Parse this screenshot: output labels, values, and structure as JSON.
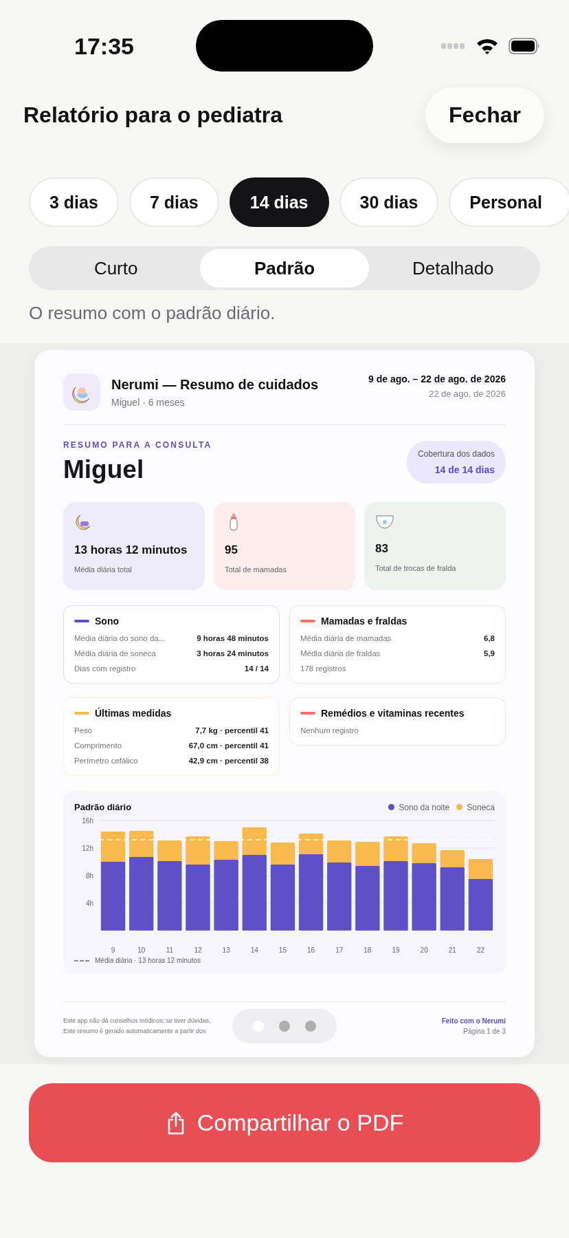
{
  "status_bar": {
    "time": "17:35"
  },
  "header": {
    "title": "Relatório para o pediatra",
    "close_button": "Fechar"
  },
  "ranges": [
    {
      "label": "3 dias",
      "selected": false
    },
    {
      "label": "7 dias",
      "selected": false
    },
    {
      "label": "14 dias",
      "selected": true
    },
    {
      "label": "30 dias",
      "selected": false
    },
    {
      "label": "Personal",
      "selected": false
    }
  ],
  "detail_levels": [
    {
      "label": "Curto",
      "selected": false
    },
    {
      "label": "Padrão",
      "selected": true
    },
    {
      "label": "Detalhado",
      "selected": false
    }
  ],
  "detail_description": "O resumo com o padrão diário.",
  "report": {
    "title": "Nerumi — Resumo de cuidados",
    "subtitle": "Miguel · 6 meses",
    "period": "9 de ago. – 22 de ago. de 2026",
    "generated": "22 de ago. de 2026",
    "kicker": "RESUMO PARA A CONSULTA",
    "child_name": "Miguel",
    "coverage": {
      "label": "Cobertura dos dados",
      "value": "14 de 14 dias"
    },
    "stats": [
      {
        "kind": "sleep",
        "value": "13 horas 12 minutos",
        "label": "Média diária total",
        "color": "#eeebfa"
      },
      {
        "kind": "bottle",
        "value": "95",
        "label": "Total de mamadas",
        "color": "#fdeeed"
      },
      {
        "kind": "diaper",
        "value": "83",
        "label": "Total de trocas de fralda",
        "color": "#eef3ef"
      }
    ],
    "sections": [
      {
        "title": "Sono",
        "color": "#5e4fc9",
        "rows": [
          {
            "label": "Média diária do sono da...",
            "value": "9 horas 48 minutos"
          },
          {
            "label": "Média diária de soneca",
            "value": "3 horas 24 minutos"
          },
          {
            "label": "Dias com registro",
            "value": "14 / 14"
          }
        ]
      },
      {
        "title": "Mamadas e fraldas",
        "color": "#f0735f",
        "rows": [
          {
            "label": "Média diária de mamadas",
            "value": "6,8"
          },
          {
            "label": "Média diária de fraldas",
            "value": "5,9"
          },
          {
            "label": "178 registros"
          }
        ]
      },
      {
        "title": "Últimas medidas",
        "color": "#f5bd4f",
        "rows": [
          {
            "label": "Peso",
            "value": "7,7 kg · percentil 41"
          },
          {
            "label": "Comprimento",
            "value": "67,0 cm · percentil 41"
          },
          {
            "label": "Perímetro cefálico",
            "value": "42,9 cm · percentil 38"
          }
        ]
      },
      {
        "title": "Remédios e vitaminas recentes",
        "color": "#f0735f",
        "rows": [
          {
            "label": "Nenhum registro"
          }
        ]
      }
    ],
    "chart": {
      "title": "Padrão diário",
      "legend_note": "Média diária · 13 horas 12 minutos",
      "chart_data": {
        "type": "bar",
        "stacked": true,
        "categories": [
          "9",
          "10",
          "11",
          "12",
          "13",
          "14",
          "15",
          "16",
          "17",
          "18",
          "19",
          "20",
          "21",
          "22"
        ],
        "series": [
          {
            "name": "Sono da noite",
            "color": "#6050c8",
            "values": [
              10.0,
              10.7,
              10.1,
              9.6,
              10.3,
              11.0,
              9.6,
              11.1,
              9.9,
              9.4,
              10.1,
              9.8,
              9.2,
              7.5
            ]
          },
          {
            "name": "Soneca",
            "color": "#f8b94d",
            "values": [
              4.4,
              3.8,
              3.0,
              4.1,
              2.7,
              4.0,
              3.2,
              3.0,
              3.2,
              3.5,
              3.6,
              2.9,
              2.5,
              2.9
            ]
          }
        ],
        "ylim": [
          0,
          16
        ],
        "yticks": [
          {
            "value": 4,
            "label": "4h"
          },
          {
            "value": 8,
            "label": "8h"
          },
          {
            "value": 12,
            "label": "12h"
          },
          {
            "value": 16,
            "label": "16h"
          }
        ],
        "grid": true,
        "ref_lines": [
          {
            "axis": "y",
            "value": 13.2
          }
        ]
      }
    },
    "footer": {
      "disclaimer": "Este app não dá conselhos médicos; se tiver dúvidas,",
      "note": "Este resumo é gerado automaticamente a partir dos",
      "made_with": "Feito com o Nerumi",
      "page": "Página 1 de 3"
    }
  },
  "pages": [
    {
      "selected": true
    },
    {
      "selected": false
    },
    {
      "selected": false
    }
  ],
  "share_button": "Compartilhar o PDF"
}
